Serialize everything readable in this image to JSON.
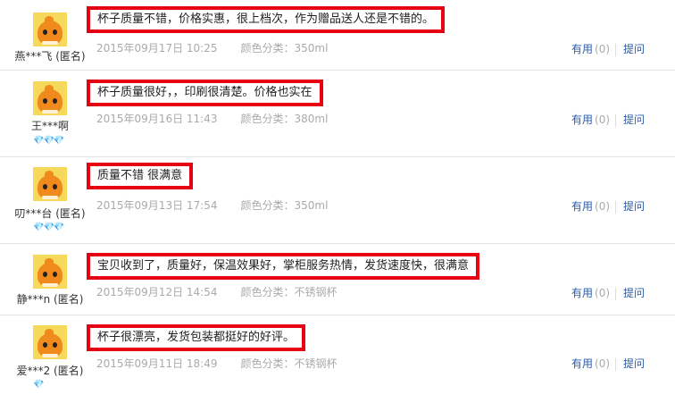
{
  "reviews": [
    {
      "username": "燕***飞 (匿名)",
      "hearts": "",
      "content": "杯子质量不错，价格实惠，很上档次，作为赠品送人还是不错的。",
      "date": "2015年09月17日 10:25",
      "color_label": "颜色分类：",
      "color_value": "350ml",
      "useful_label": "有用",
      "useful_count": "(0)",
      "ask_label": "提问"
    },
    {
      "username": "王***啊",
      "hearts": "💎💎💎",
      "content": "杯子质量很好，，印刷很清楚。价格也实在",
      "date": "2015年09月16日 11:43",
      "color_label": "颜色分类：",
      "color_value": "380ml",
      "useful_label": "有用",
      "useful_count": "(0)",
      "ask_label": "提问"
    },
    {
      "username": "叨***台 (匿名)",
      "hearts": "💎💎💎",
      "content": "质量不错 很满意",
      "date": "2015年09月13日 17:54",
      "color_label": "颜色分类：",
      "color_value": "350ml",
      "useful_label": "有用",
      "useful_count": "(0)",
      "ask_label": "提问"
    },
    {
      "username": "静***n (匿名)",
      "hearts": "",
      "content": "宝贝收到了，质量好，保温效果好，掌柜服务热情，发货速度快，很满意",
      "date": "2015年09月12日 14:54",
      "color_label": "颜色分类：",
      "color_value": "不锈钢杯",
      "useful_label": "有用",
      "useful_count": "(0)",
      "ask_label": "提问"
    },
    {
      "username": "爱***2 (匿名)",
      "hearts": "💎",
      "content": "杯子很漂亮，发货包装都挺好的好评。",
      "date": "2015年09月11日 18:49",
      "color_label": "颜色分类：",
      "color_value": "不锈钢杯",
      "useful_label": "有用",
      "useful_count": "(0)",
      "ask_label": "提问"
    }
  ]
}
